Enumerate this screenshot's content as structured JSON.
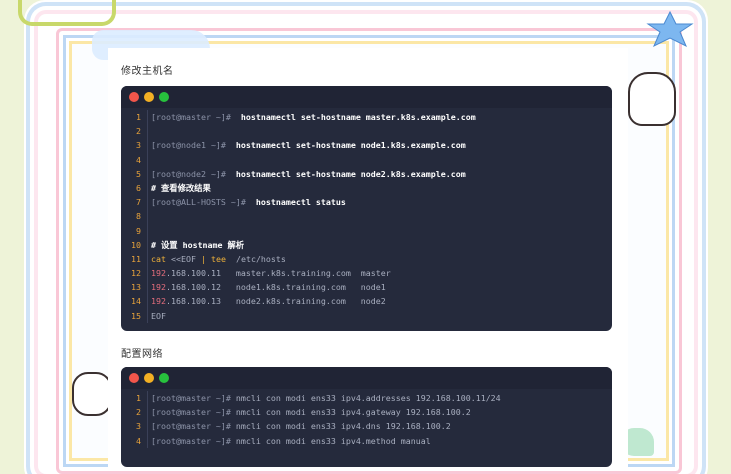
{
  "sections": [
    {
      "heading": "修改主机名",
      "lines": [
        {
          "n": "1",
          "parts": [
            {
              "t": "[root@master ~]#",
              "c": "prompt"
            },
            {
              "t": "  hostnamectl set-hostname master.k8s.example.com",
              "c": "cmd"
            }
          ]
        },
        {
          "n": "2",
          "parts": []
        },
        {
          "n": "3",
          "parts": [
            {
              "t": "[root@node1 ~]#",
              "c": "prompt"
            },
            {
              "t": "  hostnamectl set-hostname node1.k8s.example.com",
              "c": "cmd"
            }
          ]
        },
        {
          "n": "4",
          "parts": []
        },
        {
          "n": "5",
          "parts": [
            {
              "t": "[root@node2 ~]#",
              "c": "prompt"
            },
            {
              "t": "  hostnamectl set-hostname node2.k8s.example.com",
              "c": "cmd"
            }
          ]
        },
        {
          "n": "6",
          "parts": [
            {
              "t": "# 查看修改结果",
              "c": "comment"
            }
          ]
        },
        {
          "n": "7",
          "parts": [
            {
              "t": "[root@ALL-HOSTS ~]#",
              "c": "prompt"
            },
            {
              "t": "  hostnamectl status",
              "c": "cmd"
            }
          ]
        },
        {
          "n": "8",
          "parts": []
        },
        {
          "n": "9",
          "parts": []
        },
        {
          "n": "10",
          "parts": [
            {
              "t": "# 设置 hostname 解析",
              "c": "comment"
            }
          ]
        },
        {
          "n": "11",
          "parts": [
            {
              "t": "cat",
              "c": "kw"
            },
            {
              "t": " <<EOF ",
              "c": "dim"
            },
            {
              "t": "|",
              "c": "kw"
            },
            {
              "t": " ",
              "c": "dim"
            },
            {
              "t": "tee",
              "c": "kw"
            },
            {
              "t": "  /etc/hosts",
              "c": "dim"
            }
          ]
        },
        {
          "n": "12",
          "parts": [
            {
              "t": "192",
              "c": "ip"
            },
            {
              "t": ".168.100.11   master.k8s.training.com  master",
              "c": "dim"
            }
          ]
        },
        {
          "n": "13",
          "parts": [
            {
              "t": "192",
              "c": "ip"
            },
            {
              "t": ".168.100.12   node1.k8s.training.com   node1",
              "c": "dim"
            }
          ]
        },
        {
          "n": "14",
          "parts": [
            {
              "t": "192",
              "c": "ip"
            },
            {
              "t": ".168.100.13   node2.k8s.training.com   node2",
              "c": "dim"
            }
          ]
        },
        {
          "n": "15",
          "parts": [
            {
              "t": "EOF",
              "c": "dim"
            }
          ]
        }
      ]
    },
    {
      "heading": "配置网络",
      "lines": [
        {
          "n": "1",
          "parts": [
            {
              "t": "[root@master ~]#",
              "c": "prompt"
            },
            {
              "t": " nmcli con modi ens33 ipv4.addresses 192.168.100.11/24",
              "c": "dim"
            }
          ]
        },
        {
          "n": "2",
          "parts": [
            {
              "t": "[root@master ~]#",
              "c": "prompt"
            },
            {
              "t": " nmcli con modi ens33 ipv4.gateway 192.168.100.2",
              "c": "dim"
            }
          ]
        },
        {
          "n": "3",
          "parts": [
            {
              "t": "[root@master ~]#",
              "c": "prompt"
            },
            {
              "t": " nmcli con modi ens33 ipv4.dns 192.168.100.2",
              "c": "dim"
            }
          ]
        },
        {
          "n": "4",
          "parts": [
            {
              "t": "[root@master ~]#",
              "c": "prompt"
            },
            {
              "t": " nmcli con modi ens33 ipv4.method manual",
              "c": "dim"
            }
          ]
        }
      ]
    }
  ],
  "colors": {
    "code_bg": "#252a3c",
    "line_number": "#e8a33b",
    "keyword": "#f0b23a",
    "ip_highlight": "#e26d7c"
  },
  "icons": [
    "window-close-dot",
    "window-minimize-dot",
    "window-maximize-dot"
  ]
}
